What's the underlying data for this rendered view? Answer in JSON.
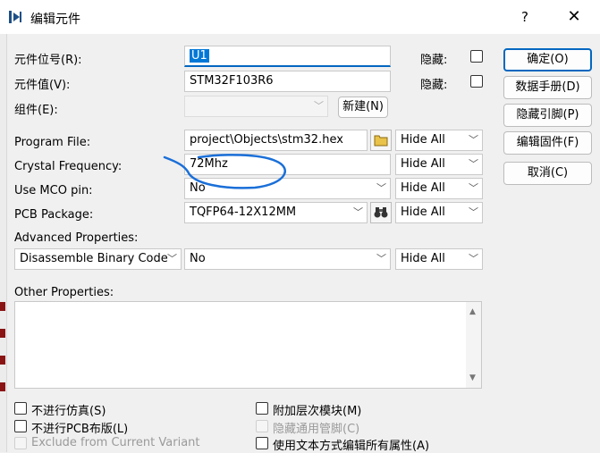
{
  "window": {
    "title": "编辑元件",
    "help": "?",
    "close": "✕"
  },
  "fields": {
    "ref_label": "元件位号(R):",
    "ref_value": "U1",
    "value_label": "元件值(V):",
    "value_value": "STM32F103R6",
    "group_label": "组件(E):",
    "hide_label_1": "隐藏:",
    "hide_label_2": "隐藏:",
    "new_button": "新建(N)"
  },
  "properties": [
    {
      "label": "Program File:",
      "value": "project\\Objects\\stm32.hex",
      "visibility": "Hide All"
    },
    {
      "label": "Crystal Frequency:",
      "value": "72Mhz",
      "visibility": "Hide All"
    },
    {
      "label": "Use MCO pin:",
      "value": "No",
      "visibility": "Hide All"
    },
    {
      "label": "PCB Package:",
      "value": "TQFP64-12X12MM",
      "visibility": "Hide All"
    }
  ],
  "advanced": {
    "title": "Advanced Properties:",
    "name": "Disassemble Binary Code",
    "value": "No",
    "visibility": "Hide All"
  },
  "other": {
    "title": "Other Properties:"
  },
  "checkboxes": [
    {
      "label": "不进行仿真(S)",
      "checked": false,
      "enabled": true
    },
    {
      "label": "不进行PCB布版(L)",
      "checked": false,
      "enabled": true
    },
    {
      "label": "Exclude from Current Variant",
      "checked": false,
      "enabled": false
    },
    {
      "label": "附加层次模块(M)",
      "checked": false,
      "enabled": true
    },
    {
      "label": "隐藏通用管脚(C)",
      "checked": false,
      "enabled": false
    },
    {
      "label": "使用文本方式编辑所有属性(A)",
      "checked": false,
      "enabled": true
    }
  ],
  "buttons": {
    "ok": "确定(O)",
    "datasheet": "数据手册(D)",
    "hidden_pins": "隐藏引脚(P)",
    "edit_firmware": "编辑固件(F)",
    "cancel": "取消(C)"
  },
  "colors": {
    "accent": "#0067c0",
    "annotation": "#1a6fd8",
    "selection": "#0078d7"
  }
}
